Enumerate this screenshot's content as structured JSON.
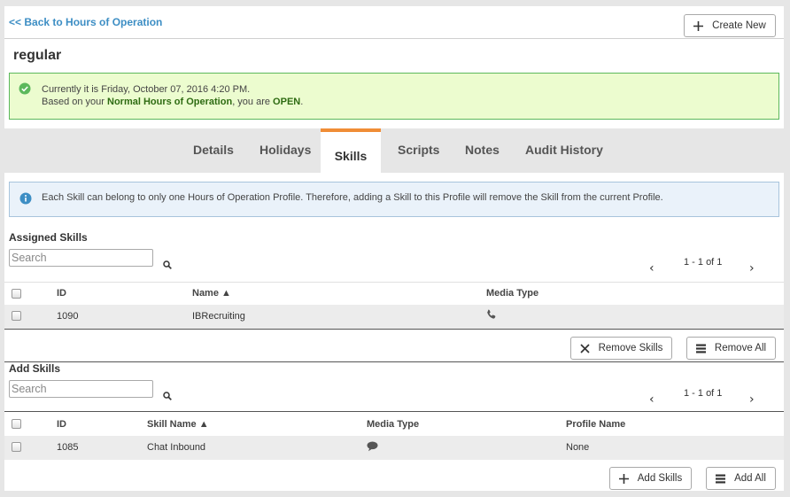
{
  "header": {
    "back_link": "<< Back to Hours of Operation",
    "create_new": "Create New"
  },
  "profile": {
    "title": "regular"
  },
  "status": {
    "line1": "Currently it is Friday, October 07, 2016 4:20 PM.",
    "line2_prefix": "Based on your ",
    "line2_bold1": "Normal Hours of Operation",
    "line2_mid": ", you are ",
    "line2_bold2": "OPEN",
    "line2_suffix": "."
  },
  "tabs": [
    {
      "label": "Details"
    },
    {
      "label": "Holidays"
    },
    {
      "label": "Skills",
      "active": true
    },
    {
      "label": "Scripts"
    },
    {
      "label": "Notes"
    },
    {
      "label": "Audit History"
    }
  ],
  "info": {
    "text": "Each Skill can belong to only one Hours of Operation Profile. Therefore, adding a Skill to this Profile will remove the Skill from the current Profile."
  },
  "assigned": {
    "title": "Assigned Skills",
    "search_placeholder": "Search",
    "pager": "1 - 1 of 1",
    "columns": [
      "ID",
      "Name ▲",
      "Media Type"
    ],
    "rows": [
      {
        "id": "1090",
        "name": "IBRecruiting",
        "media_icon": "phone-icon"
      }
    ],
    "remove_skills": "Remove Skills",
    "remove_all": "Remove All"
  },
  "add": {
    "title": "Add Skills",
    "search_placeholder": "Search",
    "pager": "1 - 1 of 1",
    "columns": [
      "ID",
      "Skill Name ▲",
      "Media Type",
      "Profile Name"
    ],
    "rows": [
      {
        "id": "1085",
        "name": "Chat Inbound",
        "media_icon": "chat-icon",
        "profile": "None"
      }
    ],
    "add_skills": "Add Skills",
    "add_all": "Add All"
  },
  "colors": {
    "link": "#3d8ec4",
    "accent": "#f08d36",
    "alert_bg": "#ecfccf",
    "alert_border": "#5cb85c",
    "info_bg": "#eaf2fa"
  }
}
